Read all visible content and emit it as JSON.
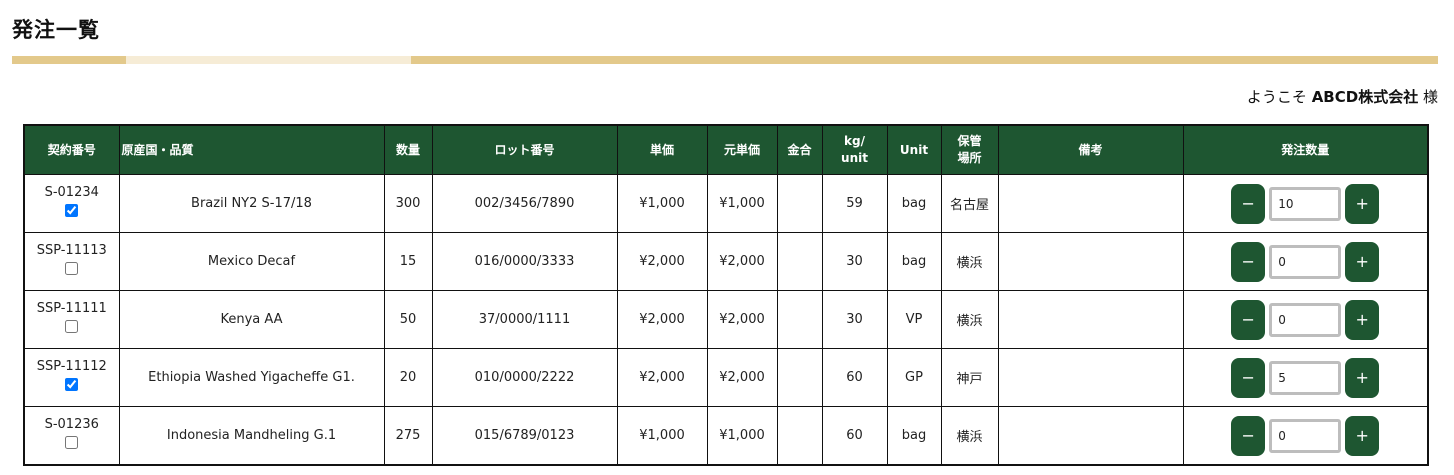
{
  "header": {
    "title": "発注一覧",
    "bar_colors": {
      "primary": "#e3c98b",
      "secondary": "#f6ecd6"
    }
  },
  "welcome": {
    "prefix": "ようこそ",
    "company": "ABCD株式会社",
    "suffix": "様"
  },
  "colors": {
    "header_bg": "#1e5631",
    "button_bg": "#1e5631",
    "border": "#111111"
  },
  "table": {
    "headers": {
      "contract": "契約番号",
      "origin": "原産国・品質",
      "quantity": "数量",
      "lot": "ロット番号",
      "unit_price": "単価",
      "base_price": "元単価",
      "metal": "金合",
      "kg_unit_1": "kg/",
      "kg_unit_2": "unit",
      "unit": "Unit",
      "storage_1": "保管",
      "storage_2": "場所",
      "remarks": "備考",
      "order_qty": "発注数量"
    },
    "rows": [
      {
        "contract": "S-01234",
        "checked": true,
        "origin": "Brazil NY2 S-17/18",
        "quantity": "300",
        "lot": "002/3456/7890",
        "unit_price": "¥1,000",
        "base_price": "¥1,000",
        "metal": "",
        "kg_unit": "59",
        "unit": "bag",
        "storage": "名古屋",
        "remarks": "",
        "order_qty": "10"
      },
      {
        "contract": "SSP-11113",
        "checked": false,
        "origin": "Mexico Decaf",
        "quantity": "15",
        "lot": "016/0000/3333",
        "unit_price": "¥2,000",
        "base_price": "¥2,000",
        "metal": "",
        "kg_unit": "30",
        "unit": "bag",
        "storage": "横浜",
        "remarks": "",
        "order_qty": "0"
      },
      {
        "contract": "SSP-11111",
        "checked": false,
        "origin": "Kenya AA",
        "quantity": "50",
        "lot": "37/0000/1111",
        "unit_price": "¥2,000",
        "base_price": "¥2,000",
        "metal": "",
        "kg_unit": "30",
        "unit": "VP",
        "storage": "横浜",
        "remarks": "",
        "order_qty": "0"
      },
      {
        "contract": "SSP-11112",
        "checked": true,
        "origin": "Ethiopia Washed Yigacheffe G1.",
        "quantity": "20",
        "lot": "010/0000/2222",
        "unit_price": "¥2,000",
        "base_price": "¥2,000",
        "metal": "",
        "kg_unit": "60",
        "unit": "GP",
        "storage": "神戸",
        "remarks": "",
        "order_qty": "5"
      },
      {
        "contract": "S-01236",
        "checked": false,
        "origin": "Indonesia Mandheling G.1",
        "quantity": "275",
        "lot": "015/6789/0123",
        "unit_price": "¥1,000",
        "base_price": "¥1,000",
        "metal": "",
        "kg_unit": "60",
        "unit": "bag",
        "storage": "横浜",
        "remarks": "",
        "order_qty": "0"
      }
    ],
    "stepper": {
      "minus_label": "−",
      "plus_label": "+"
    }
  }
}
